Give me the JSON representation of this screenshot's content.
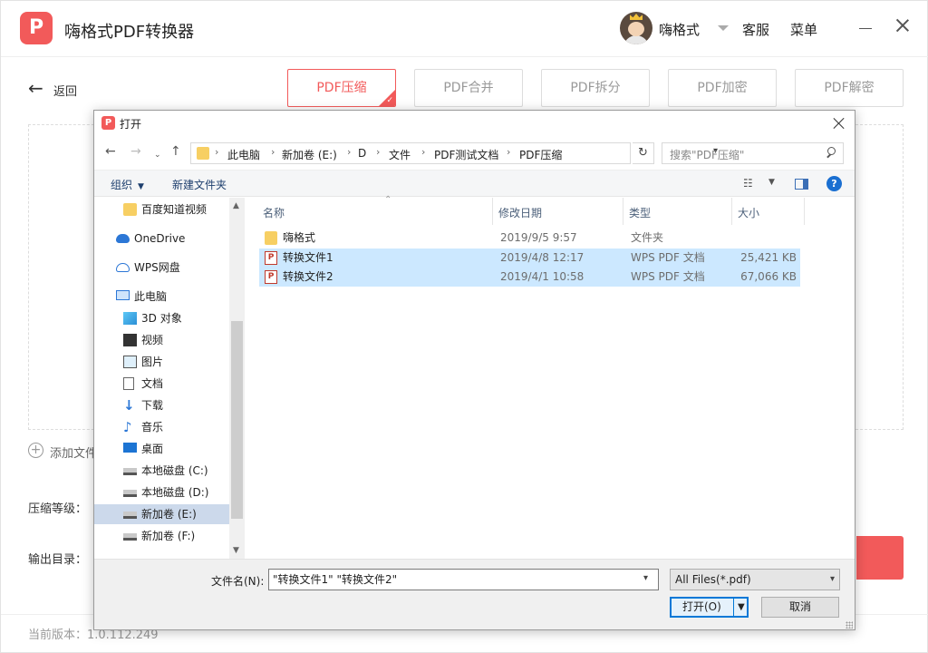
{
  "app": {
    "title": "嗨格式PDF转换器",
    "logo_text": "P",
    "username": "嗨格式",
    "kefu": "客服",
    "menu": "菜单",
    "back_label": "返回",
    "tabs": [
      {
        "label": "PDF压缩",
        "active": true
      },
      {
        "label": "PDF合并",
        "active": false
      },
      {
        "label": "PDF拆分",
        "active": false
      },
      {
        "label": "PDF加密",
        "active": false
      },
      {
        "label": "PDF解密",
        "active": false
      }
    ],
    "add_file_label": "添加文件",
    "compress_level_label": "压缩等级：",
    "output_dir_label": "输出目录：",
    "version": "当前版本：1.0.112.249",
    "accent_color": "#f25a5a"
  },
  "dialog": {
    "title": "打开",
    "breadcrumbs": [
      "此电脑",
      "新加卷 (E:)",
      "D",
      "文件",
      "PDF测试文档",
      "PDF压缩"
    ],
    "search_placeholder": "搜索\"PDF压缩\"",
    "toolbar": {
      "organize": "组织",
      "new_folder": "新建文件夹"
    },
    "tree": [
      {
        "label": "百度知道视频",
        "icon": "folder-icon",
        "selected": false
      },
      {
        "label": "OneDrive",
        "icon": "cloud-icon",
        "selected": false
      },
      {
        "label": "WPS网盘",
        "icon": "wps-cloud-icon",
        "selected": false
      },
      {
        "label": "此电脑",
        "icon": "computer-icon",
        "selected": false
      },
      {
        "label": "3D 对象",
        "icon": "3d-objects-icon",
        "selected": false
      },
      {
        "label": "视频",
        "icon": "video-icon",
        "selected": false
      },
      {
        "label": "图片",
        "icon": "pictures-icon",
        "selected": false
      },
      {
        "label": "文档",
        "icon": "documents-icon",
        "selected": false
      },
      {
        "label": "下载",
        "icon": "download-icon",
        "selected": false
      },
      {
        "label": "音乐",
        "icon": "music-icon",
        "selected": false
      },
      {
        "label": "桌面",
        "icon": "desktop-icon",
        "selected": false
      },
      {
        "label": "本地磁盘 (C:)",
        "icon": "drive-icon",
        "selected": false
      },
      {
        "label": "本地磁盘 (D:)",
        "icon": "drive-icon",
        "selected": false
      },
      {
        "label": "新加卷 (E:)",
        "icon": "drive-icon",
        "selected": true
      },
      {
        "label": "新加卷 (F:)",
        "icon": "drive-icon",
        "selected": false
      }
    ],
    "columns": [
      "名称",
      "修改日期",
      "类型",
      "大小"
    ],
    "files": [
      {
        "name": "嗨格式",
        "date": "2019/9/5 9:57",
        "type": "文件夹",
        "size": "",
        "icon": "folder-icon",
        "selected": false
      },
      {
        "name": "转换文件1",
        "date": "2019/4/8 12:17",
        "type": "WPS PDF 文档",
        "size": "25,421 KB",
        "icon": "pdf-file-icon",
        "selected": true
      },
      {
        "name": "转换文件2",
        "date": "2019/4/1 10:58",
        "type": "WPS PDF 文档",
        "size": "67,066 KB",
        "icon": "pdf-file-icon",
        "selected": true
      }
    ],
    "filename_label": "文件名(N):",
    "filename_value": "\"转换文件1\" \"转换文件2\"",
    "filetype_value": "All Files(*.pdf)",
    "open_button": "打开(O)",
    "cancel_button": "取消"
  }
}
